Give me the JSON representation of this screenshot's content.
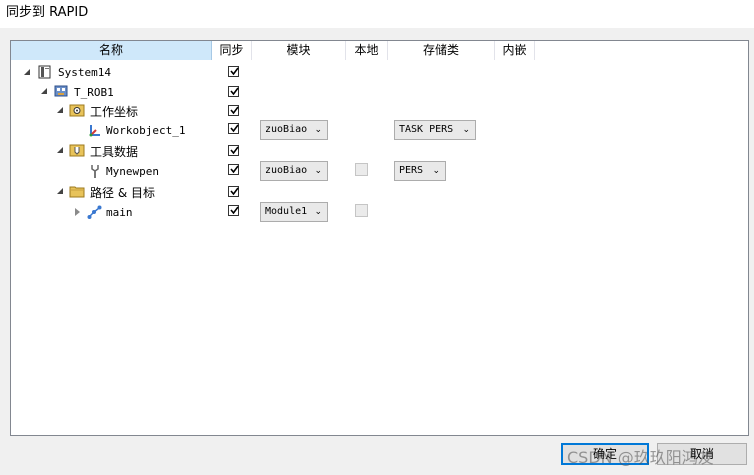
{
  "window": {
    "title": "同步到 RAPID"
  },
  "columns": [
    "名称",
    "同步",
    "模块",
    "本地",
    "存储类",
    "内嵌"
  ],
  "tree": {
    "system": {
      "label": "System14"
    },
    "task": {
      "label": "T_ROB1"
    },
    "workobject_group": {
      "label": "工作坐标"
    },
    "workobject": {
      "label": "Workobject_1",
      "module": "zuoBiao",
      "storage": "TASK PERS"
    },
    "tool_group": {
      "label": "工具数据"
    },
    "tool": {
      "label": "Mynewpen",
      "module": "zuoBiao",
      "storage": "PERS"
    },
    "paths_group": {
      "label": "路径 & 目标"
    },
    "path": {
      "label": "main",
      "module": "Module1"
    }
  },
  "buttons": {
    "ok": "确定",
    "cancel": "取消"
  },
  "watermark": "CSDN @玖玖阳鸿友",
  "colors": {
    "header_selected": "#cfe8fa",
    "default_button_border": "#0078d7"
  }
}
